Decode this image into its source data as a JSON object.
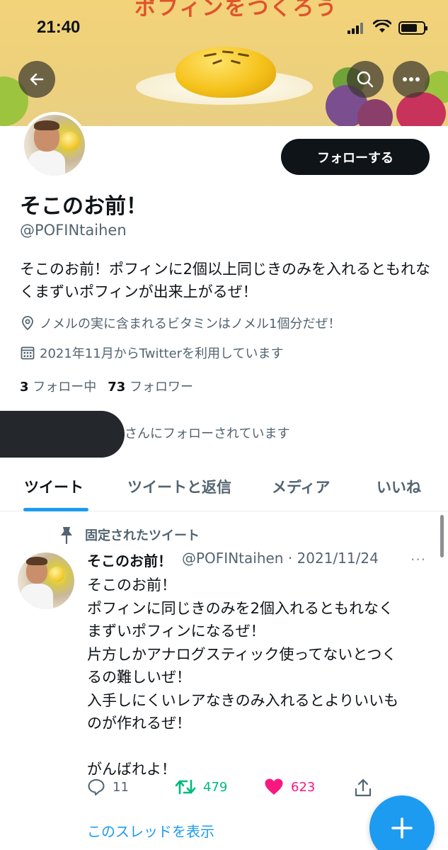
{
  "status_bar": {
    "time": "21:40"
  },
  "banner": {
    "title": "ポフィンをつくろう"
  },
  "profile": {
    "follow_button": "フォローする",
    "display_name": "そこのお前！",
    "handle": "@POFINtaihen",
    "bio": "そこのお前！ポフィンに2個以上同じきのみを入れるともれなくまずいポフィンが出来上がるぜ！",
    "location": "ノメルの実に含まれるビタミンはノメル1個分だぜ！",
    "joined": "2021年11月からTwitterを利用しています",
    "following_count": "3",
    "following_label": "フォロー中",
    "followers_count": "73",
    "followers_label": "フォロワー",
    "followed_by_text": "さんにフォローされています"
  },
  "tabs": [
    {
      "label": "ツイート"
    },
    {
      "label": "ツイートと返信"
    },
    {
      "label": "メディア"
    },
    {
      "label": "いいね"
    }
  ],
  "tweet": {
    "pinned_label": "固定されたツイート",
    "name": "そこのお前！",
    "handle_date": "@POFINtaihen · 2021/11/24",
    "more": "···",
    "body": "そこのお前！\nポフィンに同じきのみを2個入れるともれなく\nまずいポフィンになるぜ！\n片方しかアナログスティック使ってないとつく\nるの難しいぜ！\n入手しにくいレアなきのみ入れるとよりいいも\nのが作れるぜ！\n\nがんばれよ！",
    "replies": "11",
    "retweets": "479",
    "likes": "623",
    "show_thread": "このスレッドを表示"
  },
  "colors": {
    "accent": "#1d9bf0",
    "retweet": "#00ba7c",
    "like": "#f91880",
    "text_primary": "#0f1419",
    "text_secondary": "#536471"
  }
}
